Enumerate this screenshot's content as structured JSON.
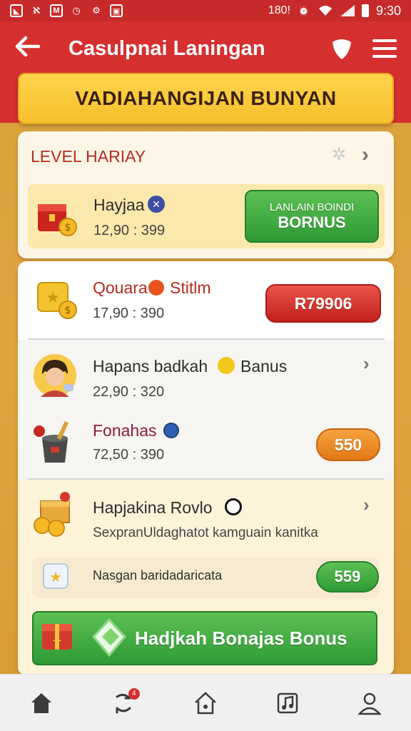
{
  "status_bar": {
    "left_icons": [
      "notification-icon",
      "tools-icon",
      "gmail-icon",
      "clock-icon",
      "settings-icon",
      "shopping-icon"
    ],
    "network_label": "180!",
    "time": "9:30"
  },
  "header": {
    "title": "Casulpnai Laningan",
    "back_icon": "arrow-left-icon",
    "shield_icon": "shield-icon",
    "menu_icon": "menu-icon"
  },
  "banner": {
    "text": "VADIAHANGIJAN BUNYAN"
  },
  "level_card": {
    "title": "LEVEL HARIAY",
    "row": {
      "name": "Hayjaa",
      "sub": "12,90 : 399",
      "button_line1": "LANLAIN BOINDI",
      "button_line2": "BORNUS"
    }
  },
  "list": {
    "item1": {
      "name": "Qouara",
      "name_tail": "Stitlm",
      "sub": "17,90 : 390",
      "button": "R79906"
    },
    "item2": {
      "name": "Hapans badkah",
      "name_tail": "Banus",
      "sub": "22,90 : 320"
    },
    "item3": {
      "name": "Fonahas",
      "sub": "72,50 : 390",
      "button": "550"
    },
    "item4": {
      "name": "Hapjakina Rovlo",
      "sub": "SexpranUldaghatot kamguain kanitka"
    },
    "item5": {
      "name": "Nasgan baridadaricata",
      "button": "559"
    },
    "bonus_button": "Hadjkah Bonajas Bonus"
  },
  "bottom_nav": {
    "items": [
      "home-icon",
      "refresh-icon",
      "house-outline-icon",
      "music-file-icon",
      "profile-icon"
    ],
    "badge": "4"
  },
  "colors": {
    "header_red": "#d62f2f",
    "banner_yellow": "#f6bf2b",
    "green": "#3aa83c",
    "red_button": "#d02a25",
    "orange_button": "#e98a22"
  }
}
